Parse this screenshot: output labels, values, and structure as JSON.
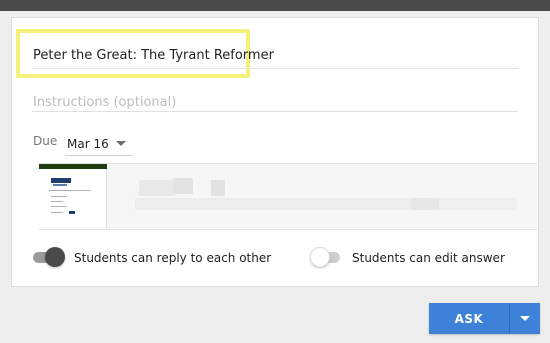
{
  "form": {
    "title": "Peter the Great: The Tyrant Reformer",
    "instructions_placeholder": "Instructions (optional)",
    "instructions_value": ""
  },
  "due": {
    "label": "Due",
    "value": "Mar 16"
  },
  "attachment": {
    "thumbnail_icon": "document-thumbnail-icon"
  },
  "settings": {
    "reply_label": "Students can reply to each other",
    "reply_enabled": true,
    "edit_label": "Students can edit answer",
    "edit_enabled": false
  },
  "actions": {
    "ask_label": "ASK",
    "dropdown_icon": "caret-down-icon"
  },
  "colors": {
    "accent": "#3d82d8",
    "highlight": "#f3f07b",
    "top_bar": "#4a4a4a"
  }
}
